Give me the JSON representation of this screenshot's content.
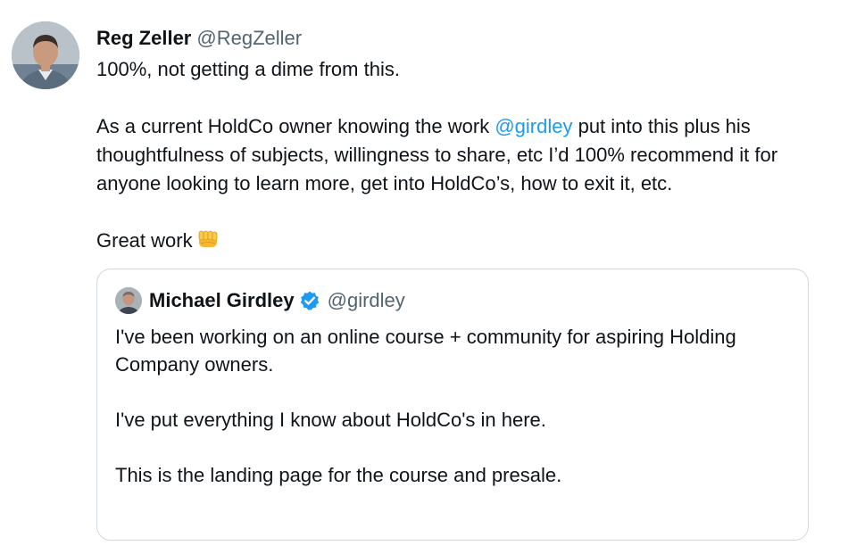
{
  "tweet": {
    "author_name": "Reg Zeller",
    "author_handle": "@RegZeller",
    "line1": "100%, not getting a dime from this.",
    "para2_before": "As a current HoldCo owner knowing the work ",
    "para2_mention": "@girdley",
    "para2_after": " put into this plus his thoughtfulness of subjects, willingness to share, etc I’d 100% recommend it for anyone looking to learn more, get into HoldCo’s, how to exit it, etc.",
    "para3": "Great work",
    "emoji_icon": "oncoming-fist-icon"
  },
  "quote": {
    "author_name": "Michael Girdley",
    "author_handle": "@girdley",
    "verified_icon": "verified-badge-icon",
    "para1": "I've been working on an online course + community for aspiring Holding Company owners.",
    "para2": "I've put everything I know about HoldCo's in here.",
    "para3": "This is the landing page for the course and presale."
  },
  "colors": {
    "text": "#0f1419",
    "secondary": "#536471",
    "link": "#1d9bf0",
    "border": "#cfd9de"
  }
}
